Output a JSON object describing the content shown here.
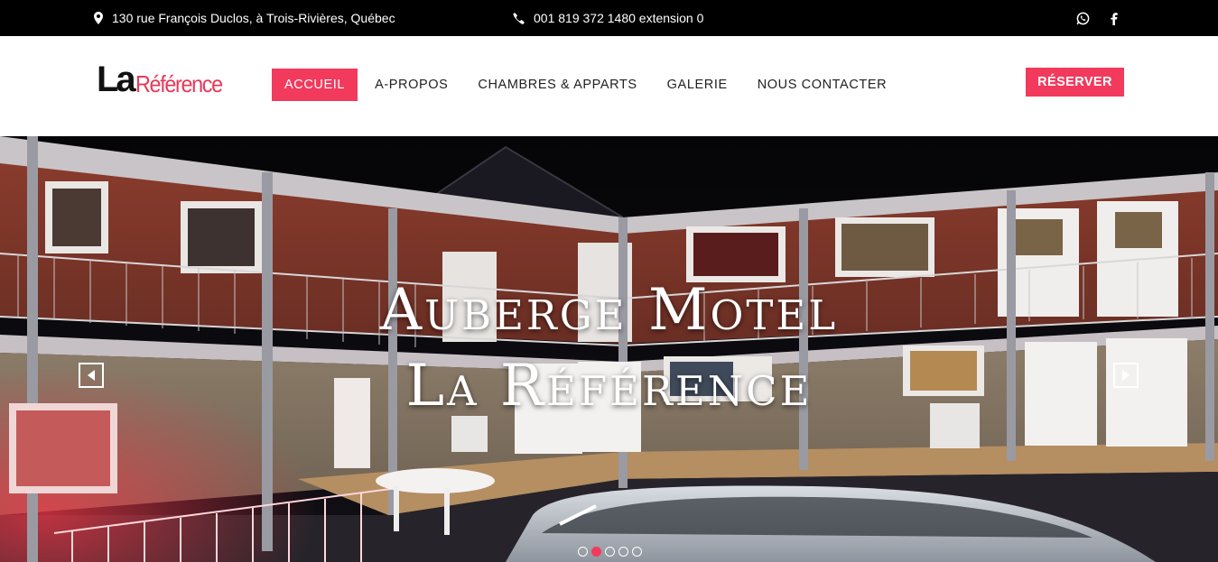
{
  "topbar": {
    "address": "130 rue François Duclos, à Trois-Rivières, Québec",
    "phone": "001 819 372 1480 extension 0",
    "social": [
      "whatsapp-icon",
      "facebook-icon"
    ]
  },
  "header": {
    "logo_part1": "La",
    "logo_part2": "Référence",
    "nav": [
      {
        "label": "ACCUEIL",
        "active": true
      },
      {
        "label": "A-PROPOS",
        "active": false
      },
      {
        "label": "CHAMBRES & APPARTS",
        "active": false
      },
      {
        "label": "GALERIE",
        "active": false
      },
      {
        "label": "NOUS CONTACTER",
        "active": false
      }
    ],
    "reserve_label": "RÉSERVER"
  },
  "hero": {
    "title_line1": "Auberge Motel",
    "title_line2": "La Référence",
    "slides_count": 5,
    "active_slide": 2
  },
  "colors": {
    "accent": "#f23a5d",
    "topbar_bg": "#000000"
  }
}
